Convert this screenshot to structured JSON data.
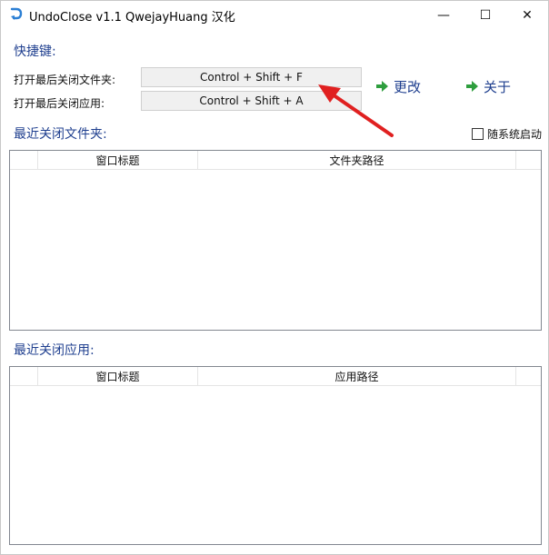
{
  "window": {
    "title": "UndoClose v1.1  QwejayHuang 汉化",
    "minimize_glyph": "—",
    "maximize_glyph": "☐",
    "close_glyph": "✕"
  },
  "hotkeys": {
    "section_title": "快捷键:",
    "folder_label": "打开最后关闭文件夹:",
    "folder_value": "Control + Shift + F",
    "app_label": "打开最后关闭应用:",
    "app_value": "Control + Shift + A"
  },
  "actions": {
    "change_label": "更改",
    "about_label": "关于",
    "arrow_icon": "green-arrow-icon"
  },
  "folders": {
    "section_title": "最近关闭文件夹:",
    "startup_checkbox_label": "随系统启动",
    "startup_checked": false,
    "columns": [
      "",
      "窗口标题",
      "文件夹路径",
      ""
    ]
  },
  "apps": {
    "section_title": "最近关闭应用:",
    "columns": [
      "",
      "窗口标题",
      "应用路径",
      ""
    ]
  },
  "colors": {
    "section_title": "#1f3f8f",
    "arrow_green": "#2e9e3e",
    "annotation_red": "#e02020"
  }
}
